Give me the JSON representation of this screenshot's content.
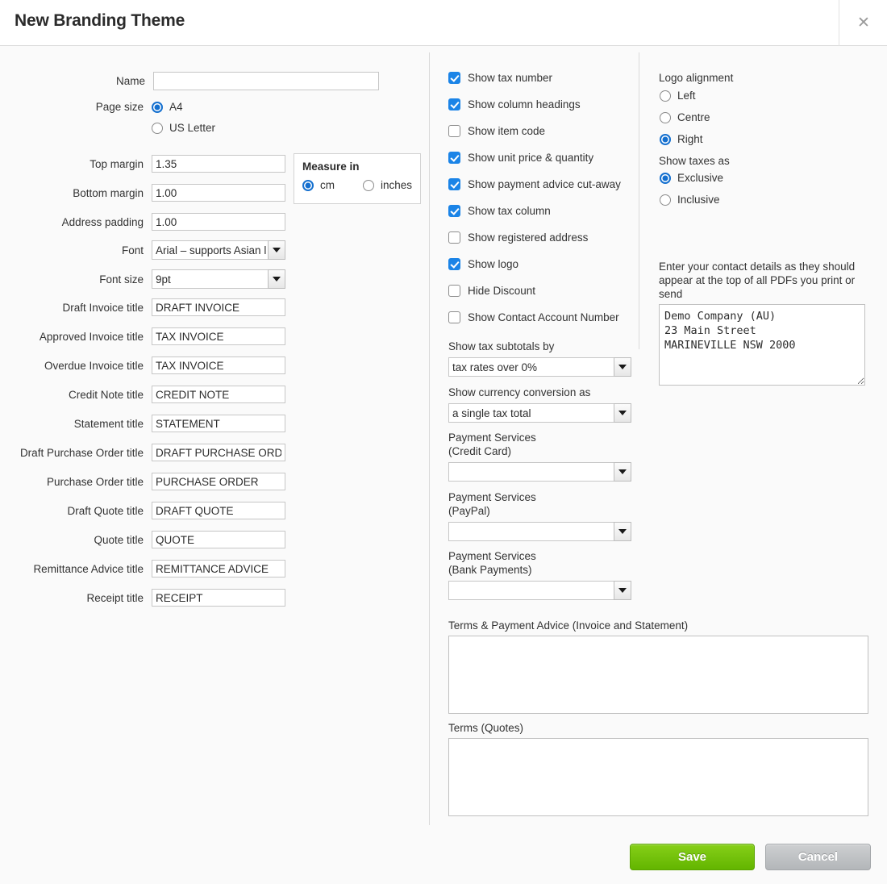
{
  "header": {
    "title": "New Branding Theme",
    "close_icon": "close-icon",
    "close_glyph": "✕"
  },
  "left_column": {
    "name": {
      "label": "Name",
      "value": "",
      "placeholder": ""
    },
    "page_size": {
      "label": "Page size",
      "options": [
        {
          "label": "A4",
          "selected": true
        },
        {
          "label": "US Letter",
          "selected": false
        }
      ]
    },
    "measure_in": {
      "title": "Measure in",
      "options": [
        {
          "label": "cm",
          "selected": true
        },
        {
          "label": "inches",
          "selected": false
        }
      ]
    },
    "fields": [
      {
        "label": "Top margin",
        "value": "1.35",
        "type": "text"
      },
      {
        "label": "Bottom margin",
        "value": "1.00",
        "type": "text"
      },
      {
        "label": "Address padding",
        "value": "1.00",
        "type": "text"
      },
      {
        "label": "Font",
        "value": "Arial – supports Asian l",
        "type": "select"
      },
      {
        "label": "Font size",
        "value": "9pt",
        "type": "select"
      },
      {
        "label": "Draft Invoice title",
        "value": "DRAFT INVOICE",
        "type": "text"
      },
      {
        "label": "Approved Invoice title",
        "value": "TAX INVOICE",
        "type": "text"
      },
      {
        "label": "Overdue Invoice title",
        "value": "TAX INVOICE",
        "type": "text"
      },
      {
        "label": "Credit Note title",
        "value": "CREDIT NOTE",
        "type": "text"
      },
      {
        "label": "Statement title",
        "value": "STATEMENT",
        "type": "text"
      },
      {
        "label": "Draft Purchase Order title",
        "value": "DRAFT PURCHASE ORDER",
        "type": "text"
      },
      {
        "label": "Purchase Order title",
        "value": "PURCHASE ORDER",
        "type": "text"
      },
      {
        "label": "Draft Quote title",
        "value": "DRAFT QUOTE",
        "type": "text"
      },
      {
        "label": "Quote title",
        "value": "QUOTE",
        "type": "text"
      },
      {
        "label": "Remittance Advice title",
        "value": "REMITTANCE ADVICE",
        "type": "text"
      },
      {
        "label": "Receipt title",
        "value": "RECEIPT",
        "type": "text"
      }
    ]
  },
  "middle_column": {
    "checkboxes": [
      {
        "label": "Show tax number",
        "checked": true
      },
      {
        "label": "Show column headings",
        "checked": true
      },
      {
        "label": "Show item code",
        "checked": false
      },
      {
        "label": "Show unit price & quantity",
        "checked": true
      },
      {
        "label": "Show payment advice cut-away",
        "checked": true
      },
      {
        "label": "Show tax column",
        "checked": true
      },
      {
        "label": "Show registered address",
        "checked": false
      },
      {
        "label": "Show logo",
        "checked": true
      },
      {
        "label": "Hide Discount",
        "checked": false
      },
      {
        "label": "Show Contact Account Number",
        "checked": false
      }
    ],
    "selects": [
      {
        "label": "Show tax subtotals by",
        "value": "tax rates over 0%"
      },
      {
        "label": "Show currency conversion as",
        "value": "a single tax total"
      },
      {
        "label": "Payment Services\n(Credit Card)",
        "label_line1": "Payment Services",
        "label_line2": "(Credit Card)",
        "value": ""
      },
      {
        "label": "Payment Services\n(PayPal)",
        "label_line1": "Payment Services",
        "label_line2": "(PayPal)",
        "value": ""
      },
      {
        "label": "Payment Services\n(Bank Payments)",
        "label_line1": "Payment Services",
        "label_line2": "(Bank Payments)",
        "value": ""
      }
    ]
  },
  "right_column": {
    "logo_alignment": {
      "label": "Logo alignment",
      "options": [
        {
          "label": "Left",
          "selected": false
        },
        {
          "label": "Centre",
          "selected": false
        },
        {
          "label": "Right",
          "selected": true
        }
      ]
    },
    "show_taxes_as": {
      "label": "Show taxes as",
      "options": [
        {
          "label": "Exclusive",
          "selected": true
        },
        {
          "label": "Inclusive",
          "selected": false
        }
      ]
    },
    "contact_details": {
      "help_text": "Enter your contact details as they should appear at the top of all PDFs you print or send",
      "value": "Demo Company (AU)\n23 Main Street\nMARINEVILLE NSW 2000"
    }
  },
  "bottom_textareas": [
    {
      "label": "Terms & Payment Advice (Invoice and Statement)",
      "value": ""
    },
    {
      "label": "Terms (Quotes)",
      "value": ""
    }
  ],
  "footer": {
    "save_label": "Save",
    "cancel_label": "Cancel"
  },
  "colors": {
    "accent_blue": "#1b84e7",
    "radio_blue": "#1570cf",
    "save_green": "#63b500",
    "cancel_gray": "#b3b6b9",
    "page_bg": "#fafafa"
  }
}
